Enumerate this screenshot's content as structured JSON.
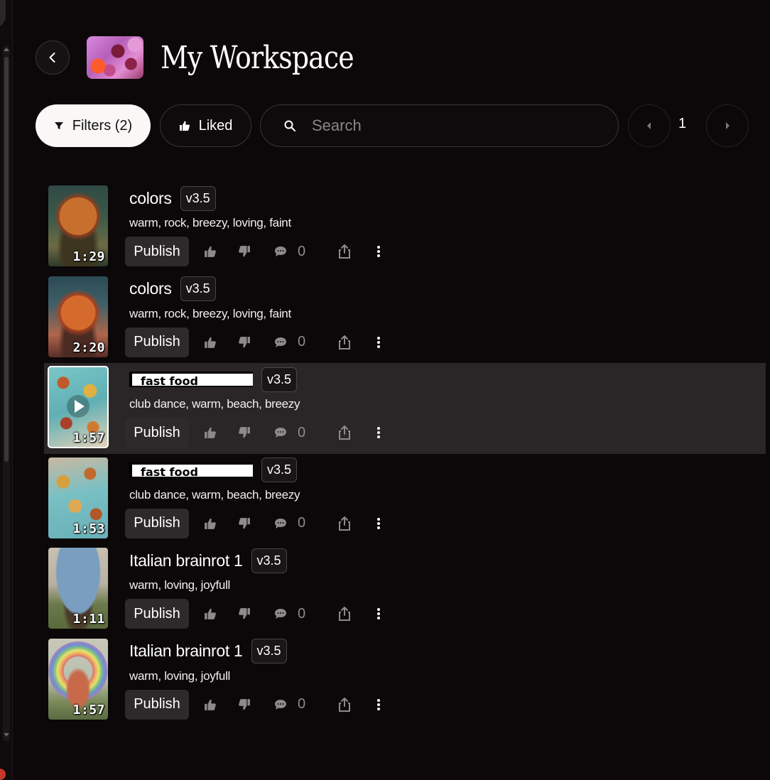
{
  "header": {
    "back_icon": "chevron-left-icon",
    "title": "My Workspace"
  },
  "toolbar": {
    "filters_label": "Filters (2)",
    "liked_label": "Liked",
    "search_placeholder": "Search",
    "search_value": "",
    "page_number": "1"
  },
  "tracks": [
    {
      "title": "colors",
      "version": "v3.5",
      "tags": "warm, rock, breezy, loving, faint",
      "duration": "1:29",
      "comments": "0",
      "publish_label": "Publish"
    },
    {
      "title": "colors",
      "version": "v3.5",
      "tags": "warm, rock, breezy, loving, faint",
      "duration": "2:20",
      "comments": "0",
      "publish_label": "Publish"
    },
    {
      "title": "fast food",
      "version": "v3.5",
      "tags": "club dance, warm, beach, breezy",
      "duration": "1:57",
      "comments": "0",
      "publish_label": "Publish"
    },
    {
      "title": "fast food",
      "version": "v3.5",
      "tags": "club dance, warm, beach, breezy",
      "duration": "1:53",
      "comments": "0",
      "publish_label": "Publish"
    },
    {
      "title": "Italian brainrot 1",
      "version": "v3.5",
      "tags": "warm, loving, joyfull",
      "duration": "1:11",
      "comments": "0",
      "publish_label": "Publish"
    },
    {
      "title": "Italian brainrot 1",
      "version": "v3.5",
      "tags": "warm, loving, joyfull",
      "duration": "1:57",
      "comments": "0",
      "publish_label": "Publish"
    }
  ],
  "colors": {
    "background": "#0c0708",
    "selected_row": "#2a2627",
    "filters_button": "#fbf7f7"
  }
}
